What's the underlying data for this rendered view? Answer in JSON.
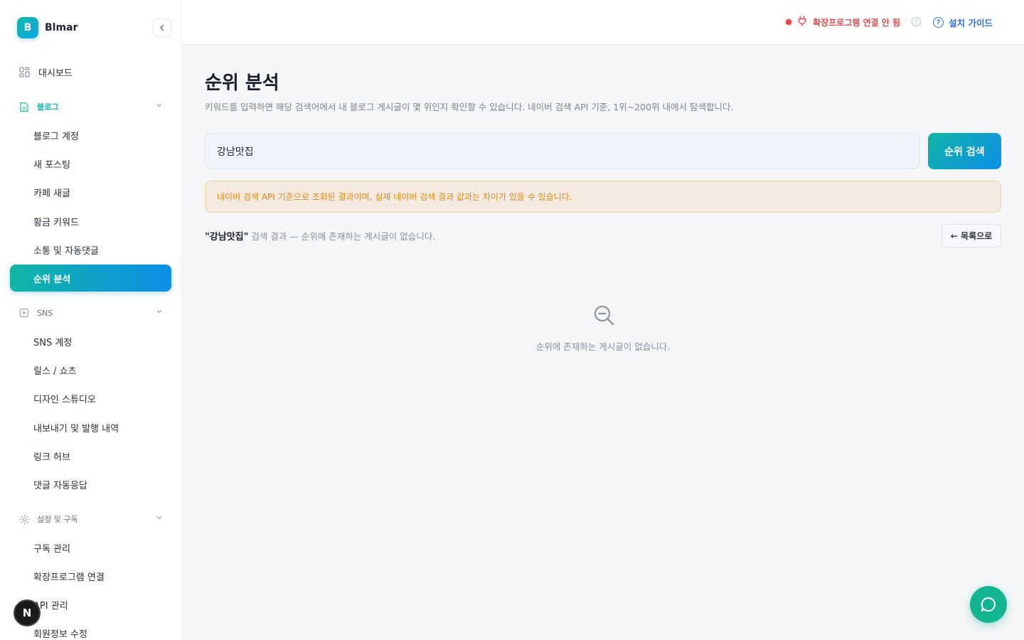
{
  "brand": {
    "logo_letter": "B",
    "name": "Blmar"
  },
  "sidebar": {
    "dashboard": "대시보드",
    "blog_section": "블로그",
    "blog_items": [
      "블로그 계정",
      "새 포스팅",
      "카페 새글",
      "황금 키워드",
      "소통 및 자동댓글",
      "순위 분석"
    ],
    "sns_section": "SNS",
    "sns_items": [
      "SNS 계정",
      "릴스 / 쇼츠",
      "디자인 스튜디오",
      "내보내기 및 발행 내역",
      "링크 허브",
      "댓글 자동응답"
    ],
    "settings_section": "설정 및 구독",
    "settings_items": [
      "구독 관리",
      "확장프로그램 연결",
      "API 관리",
      "회원정보 수정"
    ],
    "active_item": "순위 분석"
  },
  "topbar": {
    "extension_status": "확장프로그램 연결 안 됨",
    "guide_label": "설치 가이드"
  },
  "main": {
    "title": "순위 분석",
    "description": "키워드를 입력하면 해당 검색어에서 내 블로그 게시글이 몇 위인지 확인할 수 있습니다. 네이버 검색 API 기준, 1위~200위 내에서 탐색합니다.",
    "search_value": "강남맛집",
    "search_button": "순위 검색",
    "notice": "네이버 검색 API 기준으로 조회된 결과이며, 실제 네이버 검색 결과 값과는 차이가 있을 수 있습니다.",
    "result_keyword": "\"강남맛집\"",
    "result_text": " 검색 결과 — 순위에 존재하는 게시글이 없습니다.",
    "back_button": "← 목록으로",
    "empty_message": "순위에 존재하는 게시글이 없습니다."
  },
  "overlay": {
    "next_badge": "N"
  },
  "colors": {
    "accent_start": "#12b5a6",
    "accent_end": "#0d8fe8",
    "warning": "#e08a14",
    "error": "#ef4444",
    "link": "#2f6fe4",
    "chat_fab": "#12b58f"
  }
}
